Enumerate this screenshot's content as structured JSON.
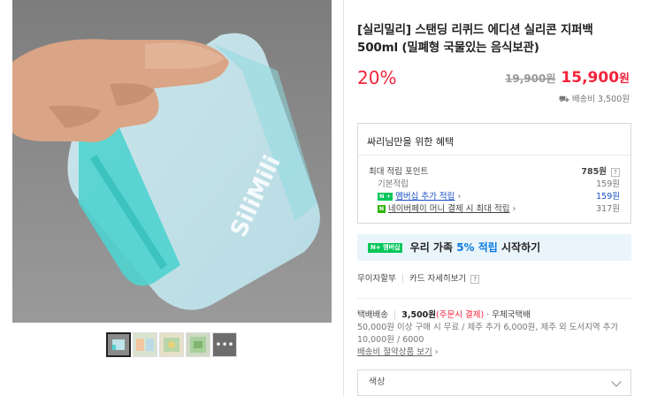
{
  "product": {
    "title": "[실리밀리] 스탠딩 리퀴드 에디션 실리콘 지퍼백 500ml (밀폐형 국물있는 음식보관)",
    "discount": "20%",
    "original_price": "19,900원",
    "sale_price": "15,900",
    "sale_unit": "원",
    "shipping_fee": "배송비 3,500원"
  },
  "image": {
    "brand_text": "SiliMili",
    "thumbnail_more_label": "•••"
  },
  "benefit": {
    "heading": "싸리님만을 위한 혜택",
    "max_points_label": "최대 적립 포인트",
    "max_points_value": "785원",
    "basic_label": "기본적립",
    "basic_value": "159원",
    "membership_badge": "N +",
    "membership_label": "멤버십 추가 적립",
    "membership_value": "159원",
    "npay_badge": "N",
    "npay_label": "네이버페이 머니 결제 시 최대 적립",
    "npay_value": "317원",
    "help": "?"
  },
  "membership_banner": {
    "badge": "N+ 멤버십",
    "text_before": "우리 가족 ",
    "highlight": "5% 적립",
    "text_after": " 시작하기"
  },
  "payment": {
    "installment": "무이자할부",
    "card_info": "카드 자세히보기",
    "help": "?"
  },
  "delivery": {
    "type": "택배배송",
    "fee": "3,500원",
    "fee_note": "(주문시 결제)",
    "carrier": "· 우체국택배",
    "conditions": "50,000원 이상 구매 시 무료 / 제주 추가 6,000원, 제주 외 도서지역 추가 10,000원 / 6000",
    "savings_link": "배송비 절약상품 보기"
  },
  "option": {
    "label": "색상"
  },
  "colors": {
    "accent_red": "#f3243b",
    "link_blue": "#1a50c8",
    "npay_green": "#03c75a",
    "banner_bg": "#eaf5fb",
    "mint": "#4fd3cf"
  }
}
